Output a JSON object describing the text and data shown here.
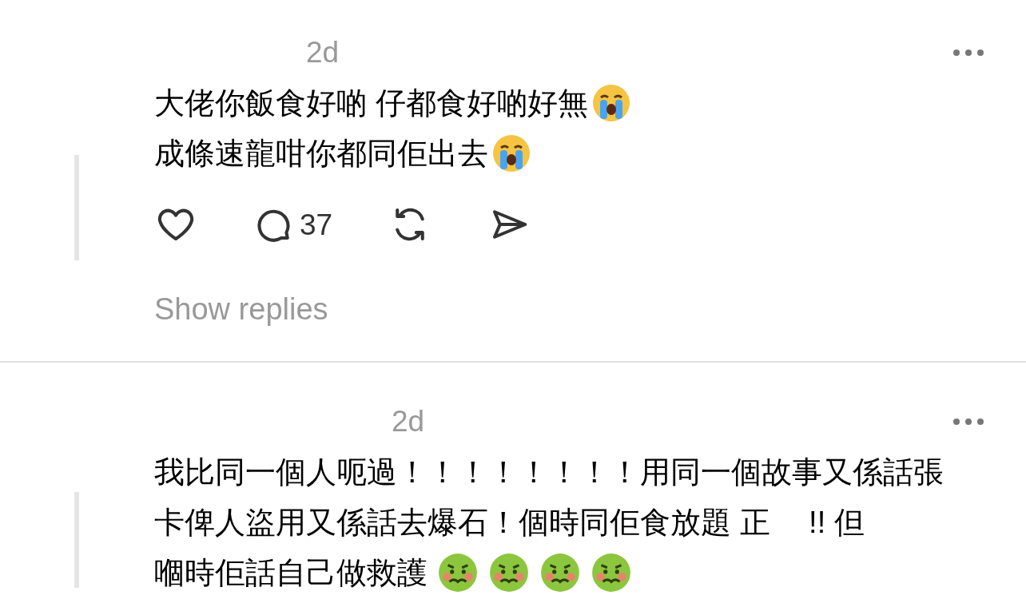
{
  "comments": [
    {
      "time": "2d",
      "lines": [
        [
          {
            "kind": "text",
            "text": "大佬你飯食好啲 仔都食好啲好無"
          },
          {
            "kind": "crying"
          }
        ],
        [
          {
            "kind": "text",
            "text": "成條速龍咁你都同佢出去"
          },
          {
            "kind": "crying"
          }
        ]
      ],
      "actions": {
        "reply_count": "37"
      },
      "show_replies": "Show replies"
    },
    {
      "time": "2d",
      "lines": [
        [
          {
            "kind": "text",
            "text": "我比同一個人呃過！！！！！！！！用同一個故事又係話張"
          }
        ],
        [
          {
            "kind": "text",
            "text": "卡俾人盜用又係話去爆石！個時同佢食放題 正　 !! 但"
          }
        ],
        [
          {
            "kind": "text",
            "text": "嗰時佢話自己做救護"
          },
          {
            "kind": "sick"
          },
          {
            "kind": "sick"
          },
          {
            "kind": "sick"
          },
          {
            "kind": "sick"
          }
        ]
      ]
    }
  ]
}
